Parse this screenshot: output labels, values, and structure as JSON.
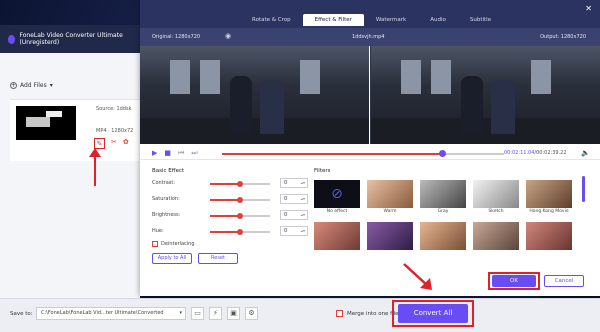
{
  "app": {
    "title": "FoneLab Video Converter Ultimate (Unregisterd)",
    "add_files": "Add Files",
    "source_label": "Source: 1ddsk",
    "format_label": "MP4 · 1280x72"
  },
  "dialog": {
    "tabs": [
      {
        "label": "Rotate & Crop",
        "active": false
      },
      {
        "label": "Effect & Filter",
        "active": true
      },
      {
        "label": "Watermark",
        "active": false
      },
      {
        "label": "Audio",
        "active": false
      },
      {
        "label": "Subtitle",
        "active": false
      }
    ],
    "original": "Original: 1280x720",
    "filename": "1ddsvjh.mp4",
    "output": "Output: 1280x720",
    "time_current": "00:02:11.04",
    "time_total": "00:02:39.22",
    "progress_fraction": 0.78,
    "basic_effect_title": "Basic Effect",
    "filters_title": "Filters",
    "adjustments": [
      {
        "label": "Contrast:",
        "value": "0",
        "level": 0.5
      },
      {
        "label": "Saturation:",
        "value": "0",
        "level": 0.5
      },
      {
        "label": "Brightness:",
        "value": "0",
        "level": 0.5
      },
      {
        "label": "Hue:",
        "value": "0",
        "level": 0.5
      }
    ],
    "deinterlacing": "Deinterlacing",
    "apply_all": "Apply to All",
    "reset": "Reset",
    "filters": [
      {
        "label": "No effect",
        "color": "#0e0e18"
      },
      {
        "label": "Warm",
        "color": "#c99b7a"
      },
      {
        "label": "Gray",
        "color": "#8a8a8a"
      },
      {
        "label": "Sketch",
        "color": "#d8d8d8"
      },
      {
        "label": "Hong Kong Movie",
        "color": "#9d7b62"
      },
      {
        "label": "",
        "color": "#a35d52"
      },
      {
        "label": "",
        "color": "#5c3a6e"
      },
      {
        "label": "",
        "color": "#bb8a6a"
      },
      {
        "label": "",
        "color": "#9a7a6a"
      },
      {
        "label": "",
        "color": "#a06060"
      }
    ],
    "ok": "OK",
    "cancel": "Cancel"
  },
  "bottom": {
    "save_to": "Save to:",
    "path": "C:\\FoneLab\\FoneLab Vid...ter Ultimate\\Converted",
    "merge": "Merge into one file",
    "convert_all": "Convert All"
  },
  "colors": {
    "accent": "#6a4cf5",
    "highlight": "#e0202a"
  }
}
